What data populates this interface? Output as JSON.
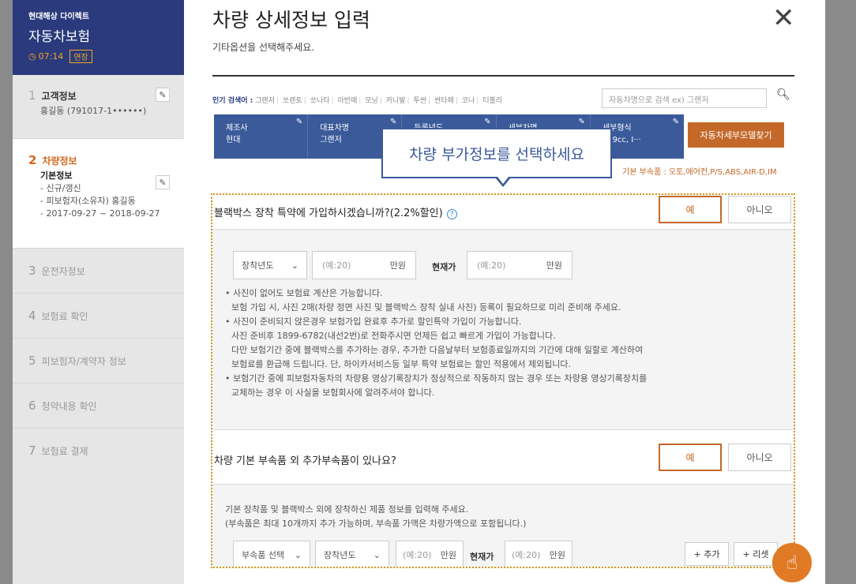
{
  "sidebar": {
    "brand_sub": "현대해상 다이렉트",
    "brand_title": "자동차보험",
    "timer": "07:14",
    "extend_label": "연장",
    "steps": [
      {
        "num": "1",
        "label": "고객정보",
        "detail": "홍길동 (791017-1••••••)"
      },
      {
        "num": "2",
        "label": "차량정보",
        "detail_title": "기본정보",
        "lines": [
          "- 신규/갱신",
          "- 피보험자(소유자) 홍길동",
          "- 2017-09-27 ~ 2018-09-27"
        ]
      },
      {
        "num": "3",
        "label": "운전자정보"
      },
      {
        "num": "4",
        "label": "보험료 확인"
      },
      {
        "num": "5",
        "label": "피보험자/계약자 정보"
      },
      {
        "num": "6",
        "label": "청약내용 확인"
      },
      {
        "num": "7",
        "label": "보험료 결제"
      }
    ]
  },
  "modal": {
    "title": "차량 상세정보 입력",
    "subtitle": "기타옵션을 선택해주세요.",
    "close": "✕"
  },
  "search": {
    "popular_label": "인기 검색어 :",
    "popular_terms": [
      "그랜저",
      "쏘렌토",
      "쏘나타",
      "아반떼",
      "모닝",
      "카니발",
      "투싼",
      "싼타페",
      "코나",
      "티볼리"
    ],
    "placeholder": "자동차명으로 검색 ex) 그랜저"
  },
  "car_bar": [
    {
      "title": "제조사",
      "value": "현대"
    },
    {
      "title": "대표차명",
      "value": "그랜저"
    },
    {
      "title": "등록년도",
      "value": ""
    },
    {
      "title": "세부차명",
      "value": ""
    },
    {
      "title": "세부형식",
      "value": "359cc, I···"
    }
  ],
  "model_button": "자동차세부모델찾기",
  "basic_parts": "기본 부속품 : 오토,에어컨,P/S,ABS,AIR-D,IM",
  "tooltip": "차량 부가정보를 선택하세요",
  "blackbox": {
    "question": "블랙박스 장착 특약에 가입하시겠습니까?(2.2%할인)",
    "yes": "예",
    "no": "아니오",
    "year_select": "장착년도",
    "price_placeholder": "(예:20)",
    "unit": "만원",
    "current_label": "현재가",
    "current_placeholder": "(예:20)",
    "notes": [
      "• 사진이 없어도 보험료 계산은 가능합니다.",
      "보험 가입 시, 사진 2매(차량 정면 사진 및 블랙박스 장착 실내 사진) 등록이 필요하므로 미리 준비해 주세요.",
      "• 사진이 준비되지 않은경우 보험가입 완료후 추가로 할인특약 가입이 가능합니다.",
      "사진 준비후 1899-6782(내선2번)로 전화주시면 언제든 쉽고 빠르게 가입이 가능합니다.",
      "다만 보험기간 중에 블랙박스를 추가하는 경우, 추가한 다음날부터 보험종료일까지의 기간에 대해 일할로 계산하여",
      "보험료를 환급해 드립니다. 단, 하이카서비스등 일부 특약 보험료는 할인 적용에서 제외됩니다.",
      "• 보험기간 중에 피보험자동차의 차량용 영상기록장치가 정상적으로 작동하지 않는 경우 또는 차량용 영상기록장치를",
      "교체하는 경우 이 사실을 보험회사에 알려주셔야 합니다."
    ]
  },
  "parts": {
    "question": "차량 기본 부속품 외 추가부속품이 있나요?",
    "yes": "예",
    "no": "아니오",
    "info_lines": [
      "기본 장착품 및 블랙박스 외에 장착하신 제품 정보를 입력해 주세요.",
      "(부속품은 최대 10개까지 추가 가능하며, 부속품 가액은 차량가액으로 포함됩니다.)"
    ],
    "part_select": "부속품 선택",
    "year_select": "장착년도",
    "price_placeholder": "(예:20)",
    "unit": "만원",
    "current_label": "현재가",
    "current_placeholder": "(예:20)",
    "add_label": "+ 추가",
    "reset_label": "+ 리셋"
  },
  "fab_icon": "hand-pointer"
}
